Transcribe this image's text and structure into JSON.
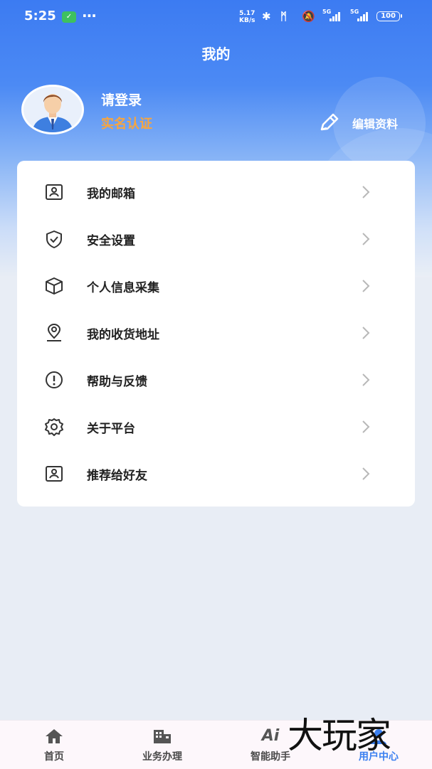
{
  "status_bar": {
    "time": "5:25",
    "wechat_icon": "wechat-icon",
    "more": "···",
    "net_speed_value": "5.17",
    "net_speed_unit": "KB/s",
    "signal1_net": "5G",
    "signal2_net": "5G",
    "battery": "100"
  },
  "header": {
    "title": "我的"
  },
  "profile": {
    "login_text": "请登录",
    "verify_link": "实名认证",
    "edit_label": "编辑资料",
    "verify_color": "#f8a53e"
  },
  "menu": {
    "items": [
      {
        "label": "我的邮箱",
        "icon": "mailbox-icon"
      },
      {
        "label": "安全设置",
        "icon": "shield-check-icon"
      },
      {
        "label": "个人信息采集",
        "icon": "box-icon"
      },
      {
        "label": "我的收货地址",
        "icon": "location-pin-icon"
      },
      {
        "label": "帮助与反馈",
        "icon": "exclamation-circle-icon"
      },
      {
        "label": "关于平台",
        "icon": "gear-icon"
      },
      {
        "label": "推荐给好友",
        "icon": "share-card-icon"
      }
    ]
  },
  "tabbar": {
    "tabs": [
      {
        "label": "首页",
        "icon": "home-icon"
      },
      {
        "label": "业务办理",
        "icon": "building-icon"
      },
      {
        "label": "智能助手",
        "icon": "ai-icon",
        "icon_text": "Ai"
      },
      {
        "label": "用户中心",
        "icon": "user-icon",
        "active": true
      }
    ],
    "active_color": "#3a7ff0"
  },
  "watermark": "大玩家",
  "colors": {
    "primary_blue": "#3c7bf2",
    "background": "#e8edf5"
  }
}
